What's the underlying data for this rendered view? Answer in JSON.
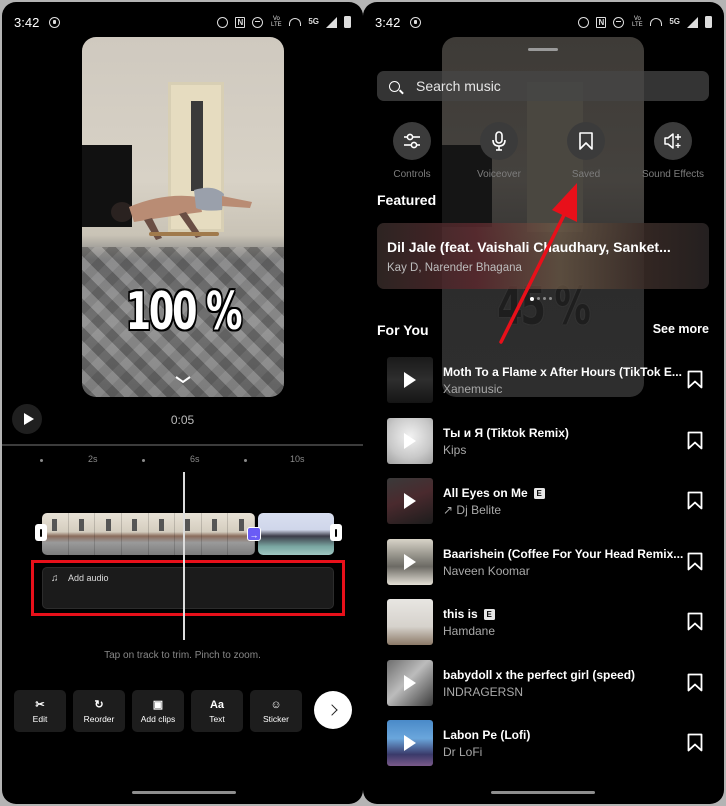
{
  "status_bar": {
    "time": "3:42",
    "icons": [
      "data-saver-icon",
      "alarm-icon",
      "nfc-icon",
      "do-not-disturb-icon",
      "volte-icon",
      "hotspot-icon",
      "5g-icon",
      "signal-icon",
      "battery-icon"
    ],
    "volte_label": "Vo LTE",
    "network_label": "5G",
    "nfc_label": "N"
  },
  "editor": {
    "preview_overlay_text": "100 %",
    "timecode": "0:05",
    "ruler_labels": [
      "2s",
      "6s",
      "10s"
    ],
    "audio_track": {
      "icon": "music-note-icon",
      "label": "Add audio"
    },
    "transition_icon": "→",
    "hint": "Tap on track to trim. Pinch to zoom.",
    "tools": [
      {
        "icon": "scissors-icon",
        "glyph": "✂",
        "label": "Edit"
      },
      {
        "icon": "reorder-icon",
        "glyph": "↻",
        "label": "Reorder"
      },
      {
        "icon": "add-clips-icon",
        "glyph": "▣",
        "label": "Add clips"
      },
      {
        "icon": "text-icon",
        "glyph": "Aa",
        "label": "Text"
      },
      {
        "icon": "sticker-icon",
        "glyph": "☺",
        "label": "Sticker"
      }
    ],
    "highlight_color": "#e8101a"
  },
  "music": {
    "background_overlay_text": "45 %",
    "search_placeholder": "Search music",
    "quick_actions": [
      {
        "icon": "sliders-icon",
        "label": "Controls"
      },
      {
        "icon": "microphone-icon",
        "label": "Voiceover"
      },
      {
        "icon": "bookmark-icon",
        "label": "Saved"
      },
      {
        "icon": "sound-effects-icon",
        "label": "Sound Effects"
      }
    ],
    "featured_title": "Featured",
    "featured": {
      "title": "Dil Jale (feat. Vaishali Chaudhary, Sanket...",
      "artist": "Kay D, Narender Bhagana",
      "page_count": 4,
      "current_page": 1
    },
    "for_you_title": "For You",
    "see_more": "See more",
    "tracks": [
      {
        "title": "Moth To a Flame x After Hours (TikTok E...",
        "artist": "Xanemusic",
        "explicit": false,
        "trending": false
      },
      {
        "title": "Ты и Я (Tiktok Remix)",
        "artist": "Kips",
        "explicit": false,
        "trending": false
      },
      {
        "title": "All Eyes on Me",
        "artist": "Dj Belite",
        "explicit": true,
        "trending": true
      },
      {
        "title": "Baarishein (Coffee For Your Head Remix...",
        "artist": "Naveen Koomar",
        "explicit": false,
        "trending": false
      },
      {
        "title": "this is",
        "artist": "Hamdane",
        "explicit": true,
        "trending": false
      },
      {
        "title": "babydoll x the perfect girl (speed)",
        "artist": "INDRAGERSN",
        "explicit": false,
        "trending": false
      },
      {
        "title": "Labon Pe (Lofi)",
        "artist": "Dr LoFi",
        "explicit": false,
        "trending": false
      }
    ],
    "explicit_badge": "E",
    "trending_glyph": "↗",
    "annotation_arrow_color": "#e8101a"
  }
}
